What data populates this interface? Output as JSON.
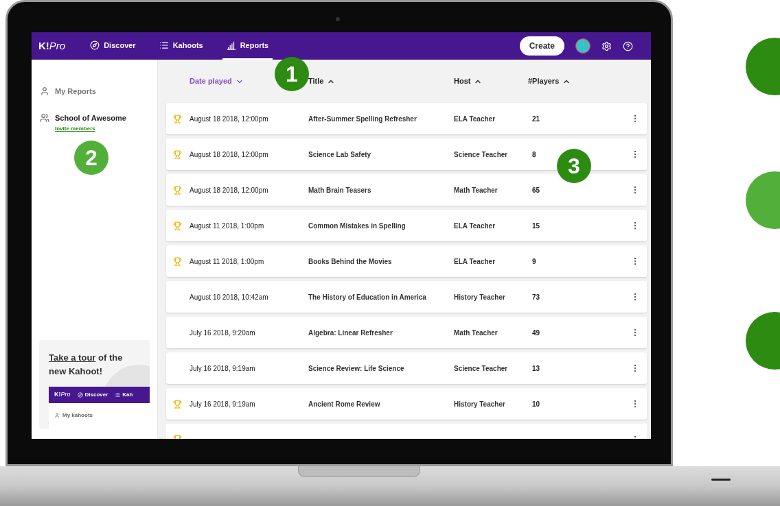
{
  "nav": {
    "logo": {
      "mark": "K!",
      "suffix": "Pro"
    },
    "items": [
      {
        "kind": "compass",
        "label": "Discover",
        "selected": false
      },
      {
        "kind": "list",
        "label": "Kahoots",
        "selected": false
      },
      {
        "kind": "chart",
        "label": "Reports",
        "selected": true
      }
    ],
    "create_button": "Create"
  },
  "sidebar": {
    "items": [
      {
        "kind": "person",
        "label": "My Reports",
        "selected": false
      },
      {
        "kind": "group",
        "label": "School of Awesome",
        "selected": true,
        "link": "Invite members"
      }
    ],
    "tour": {
      "link": "Take a tour",
      "text": " of the new Kahoot!",
      "preview": {
        "logo": {
          "mark": "K!",
          "suffix": "Pro"
        },
        "items": [
          "Discover",
          "Kah"
        ],
        "menu_item": "My kahoots"
      }
    }
  },
  "table": {
    "columns": [
      {
        "label": "Date played",
        "selected": true,
        "sort_descending": true
      },
      {
        "label": "Title",
        "selected": false,
        "sort_descending": false
      },
      {
        "label": "Host",
        "selected": false,
        "sort_descending": false
      },
      {
        "label": "#Players",
        "selected": false,
        "sort_descending": false
      }
    ],
    "rows": [
      {
        "trophy": true,
        "date": "August 18 2018, 12:00pm",
        "title": "After-Summer Spelling Refresher",
        "host": "ELA Teacher",
        "players": "21"
      },
      {
        "trophy": true,
        "date": "August 18 2018, 12:00pm",
        "title": "Science Lab Safety",
        "host": "Science Teacher",
        "players": "8"
      },
      {
        "trophy": true,
        "date": "August 18 2018, 12:00pm",
        "title": "Math Brain Teasers",
        "host": "Math Teacher",
        "players": "65"
      },
      {
        "trophy": true,
        "date": "August 11 2018, 1:00pm",
        "title": "Common Mistakes in Spelling",
        "host": "ELA Teacher",
        "players": "15"
      },
      {
        "trophy": true,
        "date": "August 11 2018, 1:00pm",
        "title": "Books Behind the Movies",
        "host": "ELA Teacher",
        "players": "9"
      },
      {
        "trophy": false,
        "date": "August 10 2018, 10:42am",
        "title": "The History of Education in America",
        "host": "History Teacher",
        "players": "73"
      },
      {
        "trophy": false,
        "date": "July 16 2018, 9:20am",
        "title": "Algebra: Linear Refresher",
        "host": "Math Teacher",
        "players": "49"
      },
      {
        "trophy": false,
        "date": "July 16 2018, 9:19am",
        "title": "Science Review: Life Science",
        "host": "Science Teacher",
        "players": "13"
      },
      {
        "trophy": true,
        "date": "July 16 2018, 9:19am",
        "title": "Ancient Rome Review",
        "host": "History Teacher",
        "players": "10"
      }
    ],
    "partial_row": {
      "trophy": true
    }
  },
  "callouts": [
    {
      "label": "1",
      "color": "#2e8b12"
    },
    {
      "label": "2",
      "color": "#52b03a"
    },
    {
      "label": "3",
      "color": "#2e8b12"
    }
  ],
  "side_markers": [
    {
      "color": "#2e8b12"
    },
    {
      "color": "#52b03a"
    },
    {
      "color": "#2e8b12"
    }
  ]
}
